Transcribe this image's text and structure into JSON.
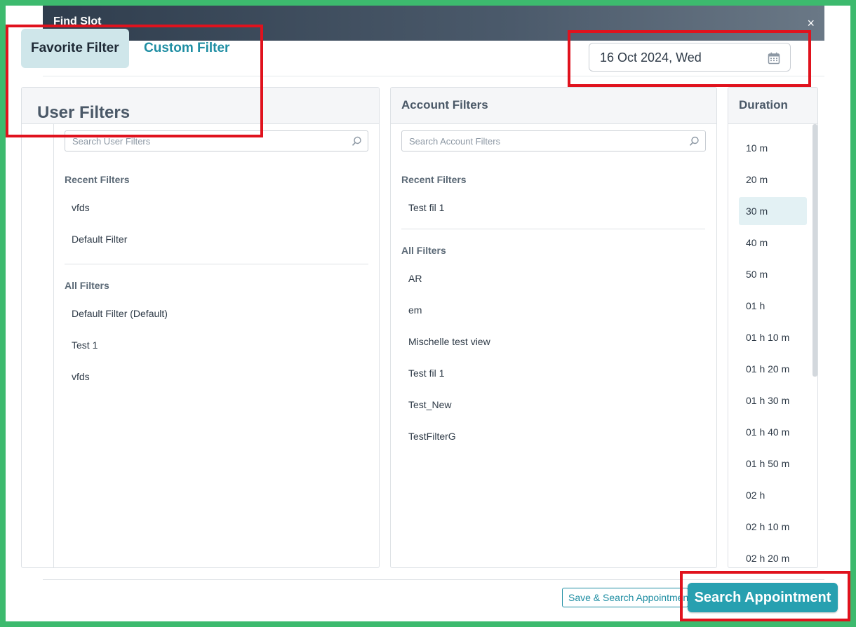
{
  "dialog": {
    "title": "Find Slot",
    "close_label": "×"
  },
  "tabs": {
    "favorite": "Favorite Filter",
    "custom": "Custom Filter"
  },
  "date": {
    "value": "16 Oct 2024, Wed",
    "icon": "calendar-icon"
  },
  "user_filters": {
    "title": "User Filters",
    "search_placeholder": "Search User Filters",
    "recent_label": "Recent Filters",
    "recent": [
      "vfds",
      "Default Filter"
    ],
    "all_label": "All Filters",
    "all": [
      "Default Filter (Default)",
      "Test 1",
      "vfds"
    ]
  },
  "account_filters": {
    "title": "Account Filters",
    "search_placeholder": "Search Account Filters",
    "recent_label": "Recent Filters",
    "recent": [
      "Test fil 1"
    ],
    "all_label": "All Filters",
    "all": [
      "AR",
      "em",
      "Mischelle test view",
      "Test fil 1",
      "Test_New",
      "TestFilterG"
    ]
  },
  "duration": {
    "title": "Duration",
    "selected": "30 m",
    "options": [
      "10 m",
      "20 m",
      "30 m",
      "40 m",
      "50 m",
      "01 h",
      "01 h 10 m",
      "01 h 20 m",
      "01 h 30 m",
      "01 h 40 m",
      "01 h 50 m",
      "02 h",
      "02 h 10 m",
      "02 h 20 m"
    ]
  },
  "footer": {
    "save_search": "Save & Search Appointment",
    "search": "Search Appointment"
  },
  "colors": {
    "accent": "#27a0b0",
    "annotation": "#e0121d",
    "frame": "#3dba6e"
  }
}
